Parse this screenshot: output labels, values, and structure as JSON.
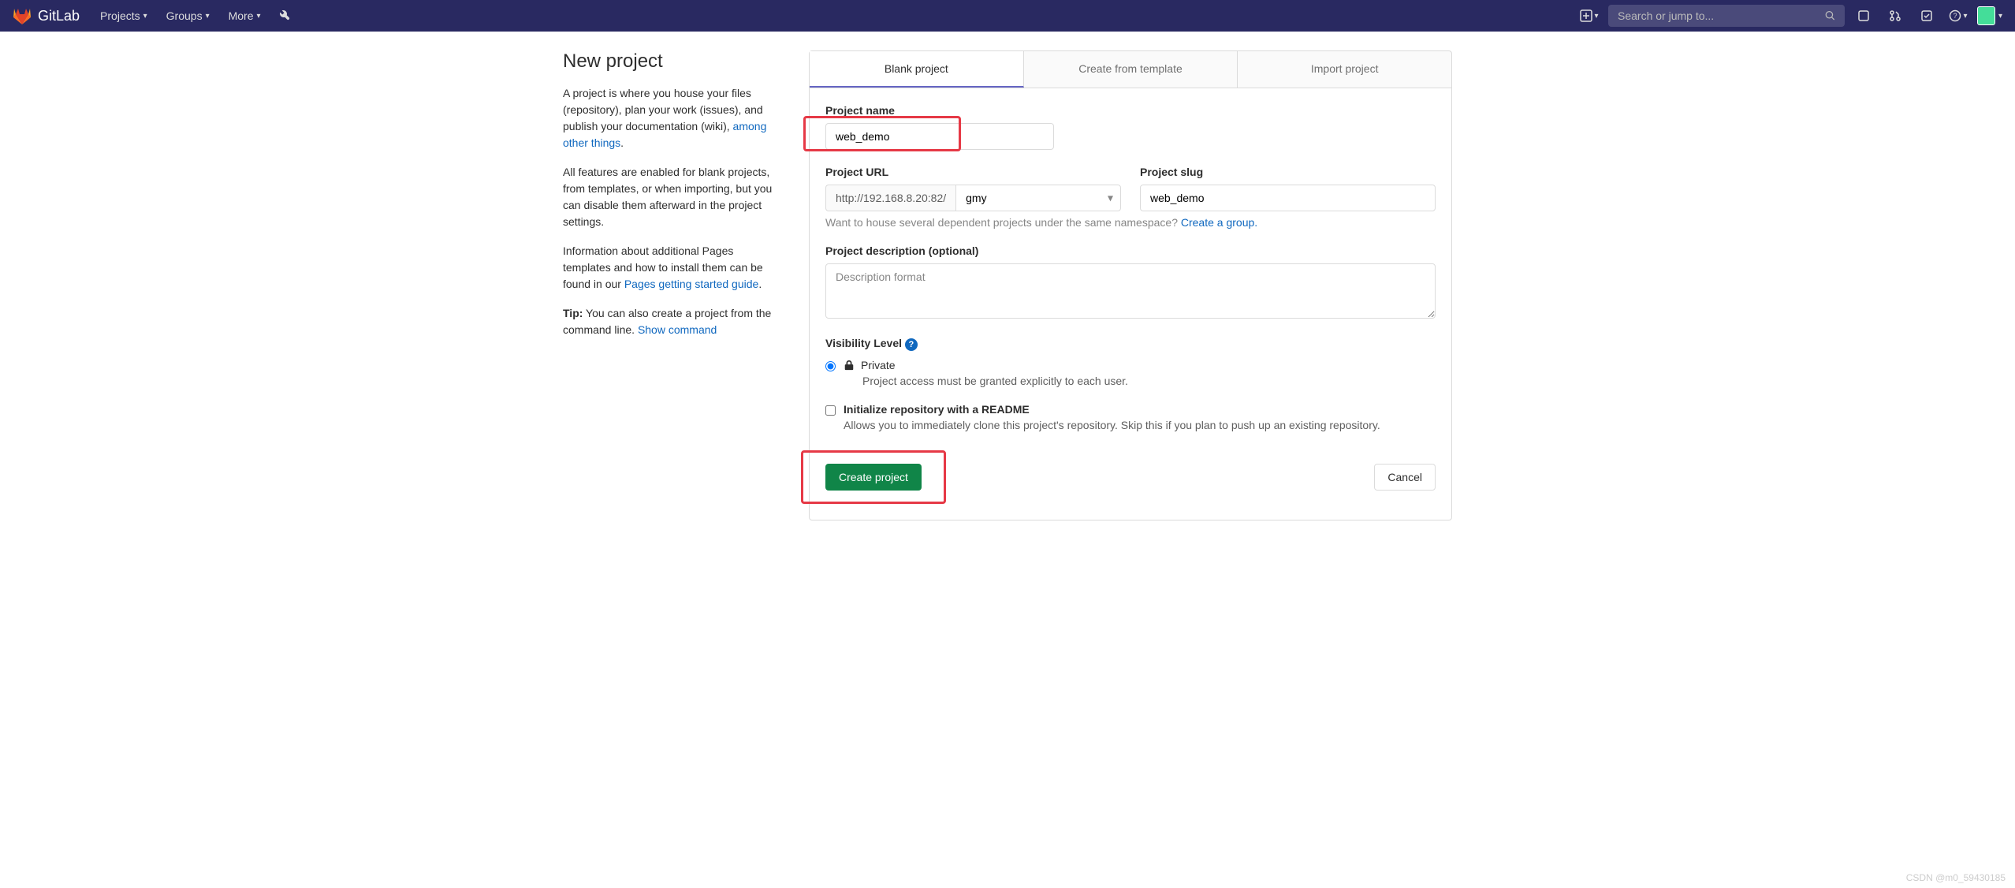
{
  "navbar": {
    "brand": "GitLab",
    "menu": {
      "projects": "Projects",
      "groups": "Groups",
      "more": "More"
    },
    "search_placeholder": "Search or jump to..."
  },
  "sidebar": {
    "title": "New project",
    "desc1_prefix": "A project is where you house your files (repository), plan your work (issues), and publish your documentation (wiki), ",
    "desc1_link": "among other things",
    "desc2": "All features are enabled for blank projects, from templates, or when importing, but you can disable them afterward in the project settings.",
    "desc3_prefix": "Information about additional Pages templates and how to install them can be found in our ",
    "desc3_link": "Pages getting started guide",
    "tip_label": "Tip:",
    "tip_text": " You can also create a project from the command line. ",
    "tip_link": "Show command"
  },
  "tabs": {
    "blank": "Blank project",
    "template": "Create from template",
    "import": "Import project"
  },
  "form": {
    "project_name_label": "Project name",
    "project_name_value": "web_demo",
    "project_url_label": "Project URL",
    "project_url_prefix": "http://192.168.8.20:82/",
    "project_url_namespace": "gmy",
    "project_slug_label": "Project slug",
    "project_slug_value": "web_demo",
    "namespace_hint_prefix": "Want to house several dependent projects under the same namespace? ",
    "namespace_hint_link": "Create a group.",
    "description_label": "Project description (optional)",
    "description_placeholder": "Description format",
    "visibility_label": "Visibility Level",
    "visibility_private_label": "Private",
    "visibility_private_desc": "Project access must be granted explicitly to each user.",
    "readme_label": "Initialize repository with a README",
    "readme_desc": "Allows you to immediately clone this project's repository. Skip this if you plan to push up an existing repository.",
    "create_button": "Create project",
    "cancel_button": "Cancel"
  },
  "watermark": "CSDN @m0_59430185"
}
